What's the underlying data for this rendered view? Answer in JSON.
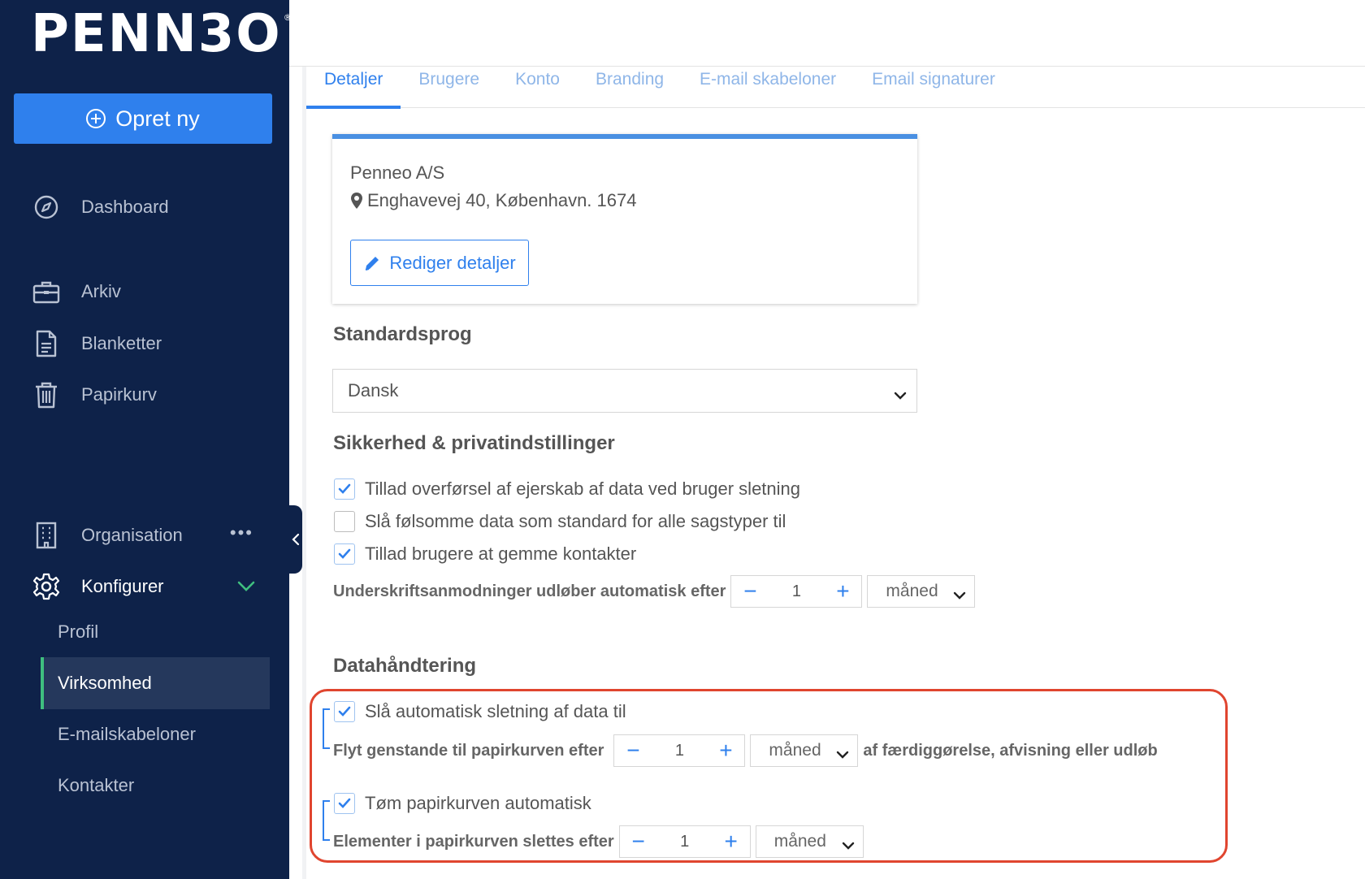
{
  "sidebar": {
    "logo": "PENN3O",
    "logo_mark": "®",
    "create_label": "Opret ny",
    "items": [
      {
        "label": "Dashboard",
        "icon": "compass-icon"
      },
      {
        "label": "Arkiv",
        "icon": "briefcase-icon"
      },
      {
        "label": "Blanketter",
        "icon": "document-icon"
      },
      {
        "label": "Papirkurv",
        "icon": "trash-icon"
      },
      {
        "label": "Organisation",
        "icon": "building-icon",
        "more": "•••"
      },
      {
        "label": "Konfigurer",
        "icon": "gear-icon"
      }
    ],
    "sub_items": [
      "Profil",
      "Virksomhed",
      "E-mailskabeloner",
      "Kontakter"
    ],
    "active_sub": "Virksomhed"
  },
  "tabs": [
    "Detaljer",
    "Brugere",
    "Konto",
    "Branding",
    "E-mail skabeloner",
    "Email signaturer"
  ],
  "active_tab": "Detaljer",
  "company_card": {
    "name": "Penneo A/S",
    "address": "Enghavevej 40, København. 1674",
    "edit_label": "Rediger detaljer"
  },
  "language": {
    "heading": "Standardsprog",
    "selected": "Dansk"
  },
  "security": {
    "heading": "Sikkerhed & privatindstillinger",
    "options": [
      {
        "label": "Tillad overførsel af ejerskab af data ved bruger sletning",
        "checked": true
      },
      {
        "label": "Slå følsomme data som standard for alle sagstyper til",
        "checked": false
      },
      {
        "label": "Tillad brugere at gemme kontakter",
        "checked": true
      }
    ],
    "expiry_label": "Underskriftsanmodninger udløber automatisk efter",
    "expiry_value": "1",
    "expiry_unit": "måned"
  },
  "data_handling": {
    "heading": "Datahåndtering",
    "auto_delete_label": "Slå automatisk sletning af data til",
    "auto_delete_checked": true,
    "move_label": "Flyt genstande til papirkurven efter",
    "move_value": "1",
    "move_unit": "måned",
    "move_suffix": "af færdiggørelse, afvisning eller udløb",
    "empty_trash_label": "Tøm papirkurven automatisk",
    "empty_trash_checked": true,
    "purge_label": "Elementer i papirkurven slettes efter",
    "purge_value": "1",
    "purge_unit": "måned"
  },
  "stepper": {
    "minus": "−",
    "plus": "+"
  },
  "colors": {
    "sidebar": "#0e2249",
    "accent": "#2f80ed",
    "active_marker": "#3fbf7f",
    "highlight": "#e0452f"
  }
}
